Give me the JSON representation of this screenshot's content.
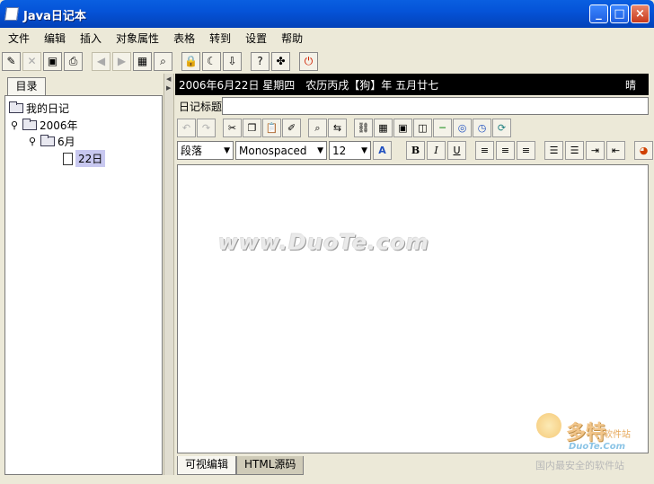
{
  "window": {
    "title": "Java日记本",
    "minimize": "_",
    "maximize": "□",
    "close": "×"
  },
  "menu": [
    "文件",
    "编辑",
    "插入",
    "对象属性",
    "表格",
    "转到",
    "设置",
    "帮助"
  ],
  "toolbar": [
    {
      "icon": "new-icon",
      "glyph": "✎"
    },
    {
      "icon": "delete-icon",
      "glyph": "✕"
    },
    {
      "icon": "save-icon",
      "glyph": "▣"
    },
    {
      "icon": "print-icon",
      "glyph": "⎙"
    },
    {
      "icon": "back-icon",
      "glyph": "◀"
    },
    {
      "icon": "forward-icon",
      "glyph": "▶"
    },
    {
      "icon": "image-icon",
      "glyph": "▦"
    },
    {
      "icon": "find-icon",
      "glyph": "⌕"
    },
    {
      "icon": "lock-icon",
      "glyph": "🔒"
    },
    {
      "icon": "moon-icon",
      "glyph": "☾"
    },
    {
      "icon": "export-icon",
      "glyph": "⇩"
    },
    {
      "icon": "help-icon",
      "glyph": "?"
    },
    {
      "icon": "puzzle-icon",
      "glyph": "✤"
    },
    {
      "icon": "exit-icon",
      "glyph": "⏻"
    }
  ],
  "sidebar": {
    "tab": "目录",
    "tree": {
      "root": "我的日记",
      "year": "2006年",
      "month": "6月",
      "day": "22日"
    }
  },
  "datebar": {
    "date": "2006年6月22日 星期四　农历丙戌【狗】年 五月廿七",
    "weather": "晴"
  },
  "diary_title": {
    "label": "日记标题",
    "value": ""
  },
  "format1": [
    {
      "icon": "undo-icon",
      "glyph": "↶",
      "disabled": true
    },
    {
      "icon": "redo-icon",
      "glyph": "↷",
      "disabled": true
    },
    {
      "icon": "cut-icon",
      "glyph": "✂"
    },
    {
      "icon": "copy-icon",
      "glyph": "❐"
    },
    {
      "icon": "paste-icon",
      "glyph": "📋"
    },
    {
      "icon": "brush-icon",
      "glyph": "✐"
    },
    {
      "icon": "find-text-icon",
      "glyph": "⌕"
    },
    {
      "icon": "replace-icon",
      "glyph": "⇆"
    },
    {
      "icon": "link-icon",
      "glyph": "⛓"
    },
    {
      "icon": "table-icon",
      "glyph": "▦"
    },
    {
      "icon": "insert-image-icon",
      "glyph": "▣"
    },
    {
      "icon": "frame-icon",
      "glyph": "◫"
    },
    {
      "icon": "hr-icon",
      "glyph": "─"
    },
    {
      "icon": "circle-icon",
      "glyph": "◎"
    },
    {
      "icon": "clock-icon",
      "glyph": "◷"
    },
    {
      "icon": "refresh-icon",
      "glyph": "⟳"
    }
  ],
  "format2": {
    "paragraph": "段落",
    "font": "Monospaced",
    "size": "12",
    "bold": "B",
    "italic": "I",
    "underline": "U"
  },
  "bottom_tabs": {
    "visual": "可视编辑",
    "html": "HTML源码"
  },
  "watermark": "www.DuoTe.com",
  "logo": {
    "main": "多特",
    "sub1": "软件站",
    "sub2": "DuoTe.Com",
    "sub3": "国内最安全的软件站"
  }
}
